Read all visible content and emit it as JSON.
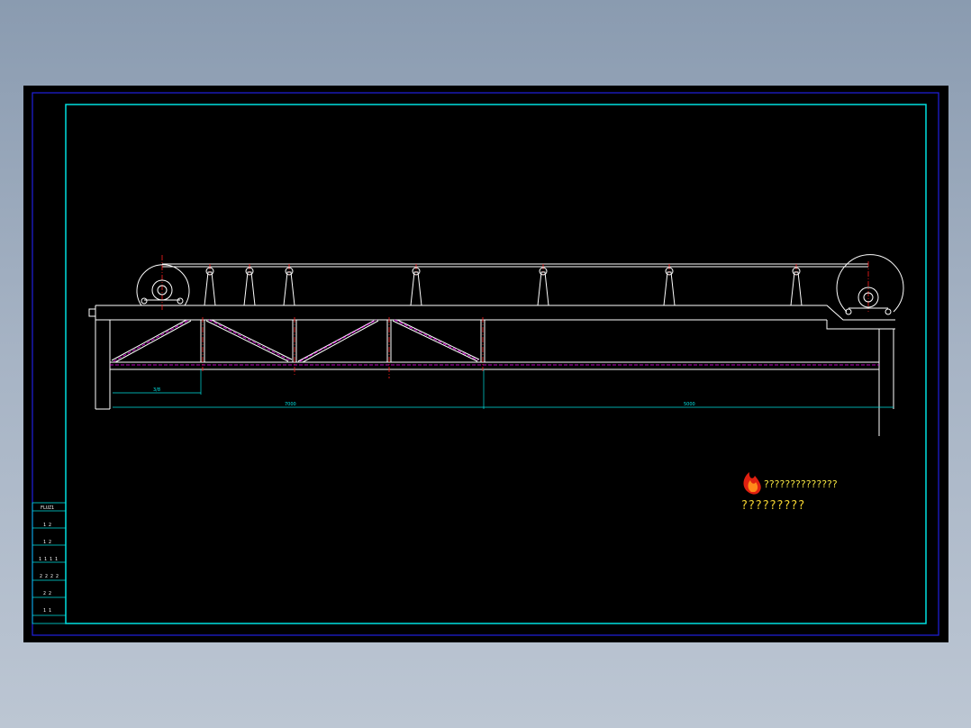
{
  "drawing": {
    "dimensions": {
      "bay_width": "3/8",
      "span_left": "7000",
      "span_right": "5000"
    },
    "title_block": {
      "rows": [
        "FLUZ1",
        "1  2",
        "1  2",
        "1 1 1 1",
        "2 2 2 2",
        "2  2",
        "1  1"
      ]
    },
    "watermark": {
      "line1": "??????????????",
      "line2": "?????????"
    }
  },
  "colors": {
    "background": "#000000",
    "outer_frame": "#2020e0",
    "inner_frame": "#00e0e0",
    "geometry": "#ffffff",
    "centerline": "#ff2020",
    "hidden_line": "#ff00ff",
    "dimension": "#00e5e5"
  }
}
